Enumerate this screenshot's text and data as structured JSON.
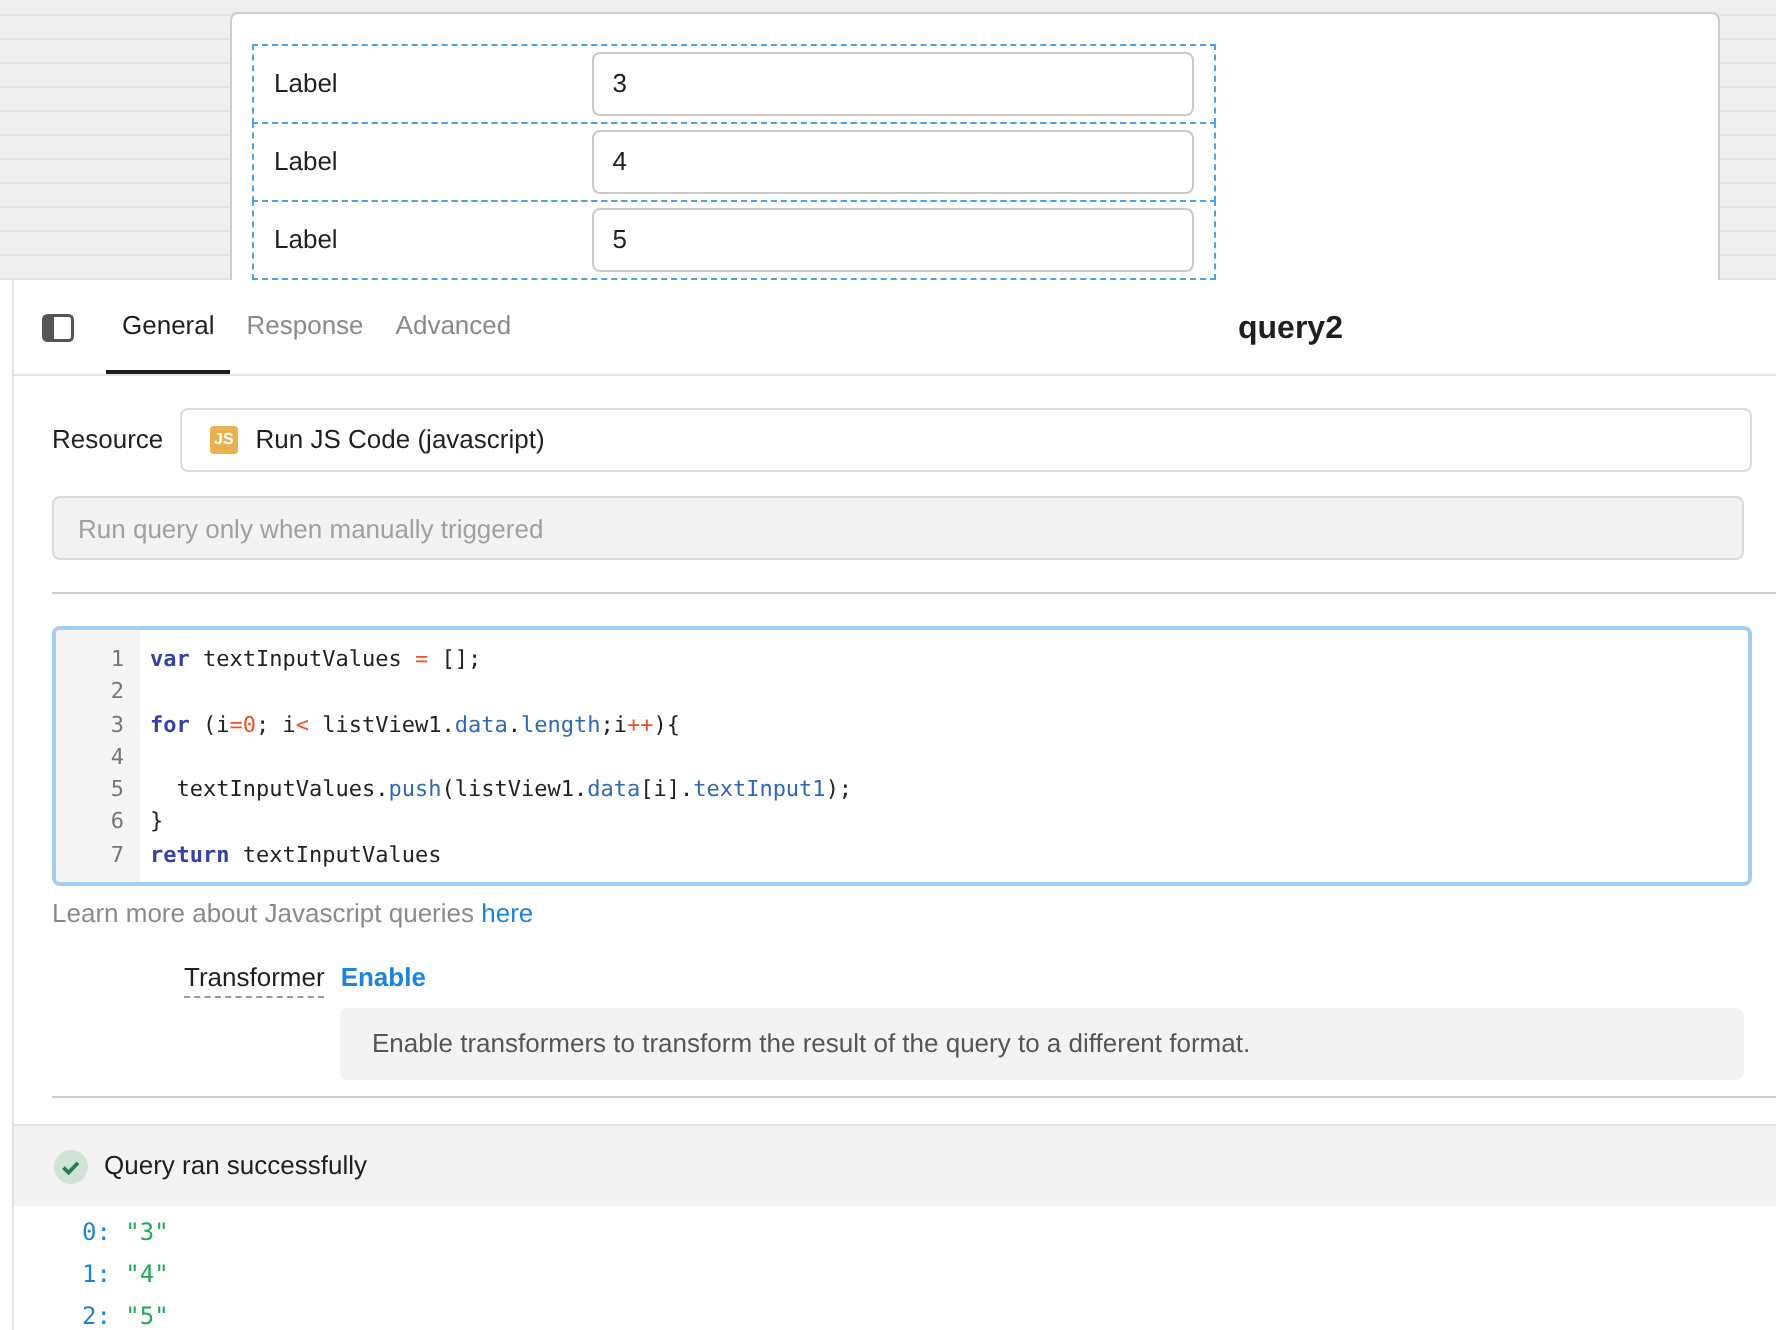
{
  "canvas": {
    "rows": [
      {
        "label": "Label",
        "value": "3"
      },
      {
        "label": "Label",
        "value": "4"
      },
      {
        "label": "Label",
        "value": "5"
      }
    ]
  },
  "tabs": [
    {
      "label": "General",
      "selected": true
    },
    {
      "label": "Response",
      "selected": false
    },
    {
      "label": "Advanced",
      "selected": false
    }
  ],
  "query_title": "query2",
  "resource": {
    "label": "Resource",
    "badge": "JS",
    "value": "Run JS Code (javascript)"
  },
  "trigger": {
    "placeholder": "Run query only when manually triggered"
  },
  "code": [
    {
      "number": "1",
      "tokens": [
        {
          "kind": "kw",
          "text": "var"
        },
        {
          "kind": "plain",
          "text": " textInputValues "
        },
        {
          "kind": "op",
          "text": "="
        },
        {
          "kind": "plain",
          "text": " [];"
        }
      ]
    },
    {
      "number": "2"
    },
    {
      "number": "3",
      "tokens": [
        {
          "kind": "kw",
          "text": "for"
        },
        {
          "kind": "plain",
          "text": " (i"
        },
        {
          "kind": "op",
          "text": "="
        },
        {
          "kind": "num",
          "text": "0"
        },
        {
          "kind": "plain",
          "text": "; i"
        },
        {
          "kind": "op",
          "text": "<"
        },
        {
          "kind": "plain",
          "text": " listView1."
        },
        {
          "kind": "prop",
          "text": "data"
        },
        {
          "kind": "plain",
          "text": "."
        },
        {
          "kind": "prop",
          "text": "length"
        },
        {
          "kind": "plain",
          "text": ";i"
        },
        {
          "kind": "op",
          "text": "++"
        },
        {
          "kind": "plain",
          "text": "){"
        }
      ]
    },
    {
      "number": "4"
    },
    {
      "number": "5",
      "tokens": [
        {
          "kind": "plain",
          "text": "  textInputValues."
        },
        {
          "kind": "prop",
          "text": "push"
        },
        {
          "kind": "plain",
          "text": "(listView1."
        },
        {
          "kind": "prop",
          "text": "data"
        },
        {
          "kind": "plain",
          "text": "[i]."
        },
        {
          "kind": "prop",
          "text": "textInput1"
        },
        {
          "kind": "plain",
          "text": ");"
        }
      ]
    },
    {
      "number": "6",
      "tokens": [
        {
          "kind": "plain",
          "text": "}"
        }
      ]
    },
    {
      "number": "7",
      "tokens": [
        {
          "kind": "kw",
          "text": "return"
        },
        {
          "kind": "plain",
          "text": " textInputValues"
        }
      ]
    }
  ],
  "learn_more": {
    "text": "Learn more about Javascript queries",
    "link": "here"
  },
  "transformer": {
    "label": "Transformer",
    "action": "Enable",
    "help": "Enable transformers to transform the result of the query to a different format."
  },
  "result": {
    "status": "Query ran successfully",
    "items": [
      {
        "key": "0:",
        "value": "\"3\""
      },
      {
        "key": "1:",
        "value": "\"4\""
      },
      {
        "key": "2:",
        "value": "\"5\""
      }
    ]
  }
}
